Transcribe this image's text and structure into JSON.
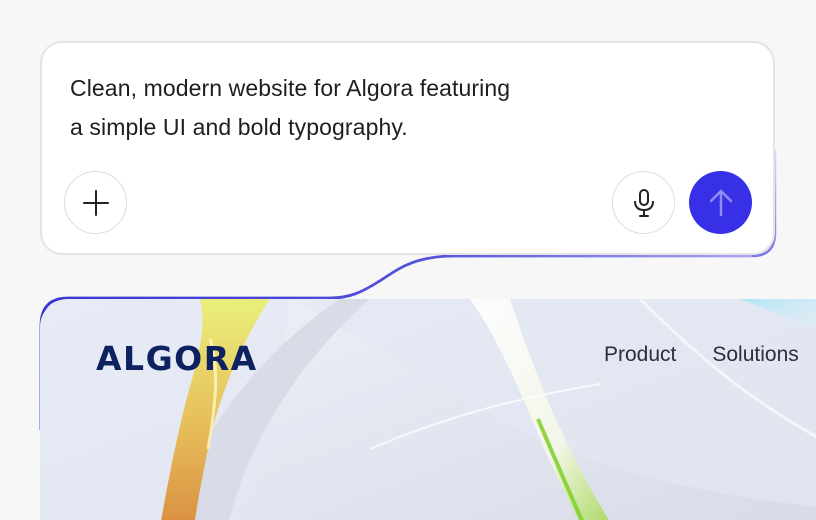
{
  "prompt": {
    "line1": "Clean, modern website for Algora featuring",
    "line2": "a simple UI and bold typography."
  },
  "buttons": {
    "add_icon": "plus-icon",
    "mic_icon": "microphone-icon",
    "send_icon": "arrow-up-icon"
  },
  "preview": {
    "logo": "ALGORA",
    "nav": [
      "Product",
      "Solutions"
    ]
  },
  "colors": {
    "accent": "#3730e6",
    "logo": "#0e2160",
    "connector_start": "#3d3ad6",
    "connector_end": "#9a97ee"
  }
}
